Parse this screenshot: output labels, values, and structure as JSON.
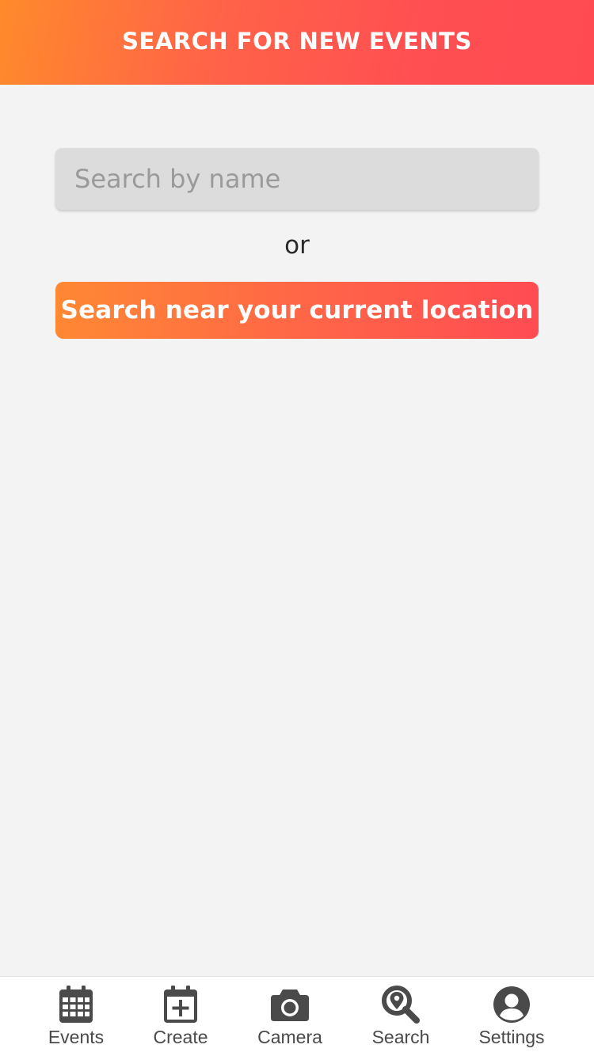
{
  "header": {
    "title": "SEARCH FOR NEW EVENTS"
  },
  "search": {
    "value": "",
    "placeholder": "Search by name"
  },
  "separator": {
    "text": "or"
  },
  "location_button": {
    "label": "Search near your current location"
  },
  "tabbar": {
    "tabs": [
      {
        "label": "Events",
        "icon": "calendar-grid-icon"
      },
      {
        "label": "Create",
        "icon": "calendar-plus-icon"
      },
      {
        "label": "Camera",
        "icon": "camera-icon"
      },
      {
        "label": "Search",
        "icon": "search-location-icon"
      },
      {
        "label": "Settings",
        "icon": "user-circle-icon"
      }
    ]
  },
  "colors": {
    "accent_orange": "#ff8a2c",
    "accent_red": "#ff4a52",
    "background": "#f3f3f3",
    "input_background": "#dcdcdc",
    "icon_gray": "#4a4a4a"
  }
}
